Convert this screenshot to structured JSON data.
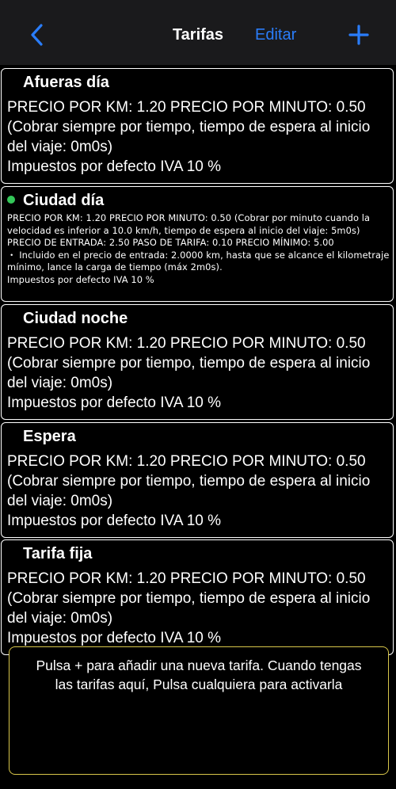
{
  "navbar": {
    "title": "Tarifas",
    "edit_label": "Editar",
    "back_icon": "chevron-left-icon",
    "add_icon": "plus-icon",
    "accent_color": "#2a7dfa"
  },
  "tariffs": [
    {
      "name": "Afueras día",
      "active": false,
      "lines": [
        "PRECIO POR KM: 1.20 PRECIO POR MINUTO: 0.50 (Cobrar siempre por tiempo, tiempo de espera al inicio del viaje: 0m0s)",
        "Impuestos por defecto IVA 10 %"
      ]
    },
    {
      "name": "Ciudad día",
      "active": true,
      "lines": [
        "PRECIO POR KM: 1.20 PRECIO POR MINUTO: 0.50 (Cobrar por minuto cuando la velocidad es inferior a 10.0 km/h, tiempo de espera al inicio del viaje: 5m0s) PRECIO DE ENTRADA: 2.50 PASO DE TARIFA: 0.10 PRECIO MÍNIMO: 5.00",
        "・ Incluido en el precio de entrada: 2.0000 km, hasta que se alcance el kilometraje mínimo, lance la carga de tiempo (máx 2m0s).",
        "Impuestos por defecto IVA 10 %"
      ]
    },
    {
      "name": "Ciudad noche",
      "active": false,
      "lines": [
        "PRECIO POR KM: 1.20 PRECIO POR MINUTO: 0.50 (Cobrar siempre por tiempo, tiempo de espera al inicio del viaje: 0m0s)",
        "Impuestos por defecto IVA 10 %"
      ]
    },
    {
      "name": "Espera",
      "active": false,
      "lines": [
        "PRECIO POR KM: 1.20 PRECIO POR MINUTO: 0.50 (Cobrar siempre por tiempo, tiempo de espera al inicio del viaje: 0m0s)",
        "Impuestos por defecto IVA 10 %"
      ]
    },
    {
      "name": "Tarifa fija",
      "active": false,
      "lines": [
        "PRECIO POR KM: 1.20 PRECIO POR MINUTO: 0.50 (Cobrar siempre por tiempo, tiempo de espera al inicio del viaje: 0m0s)",
        "Impuestos por defecto IVA 10 %"
      ]
    }
  ],
  "hint": {
    "text": "Pulsa + para añadir una nueva tarifa. Cuando tengas las tarifas aquí, Pulsa cualquiera para activarla",
    "border_color": "#d8c64a"
  },
  "active_indicator_color": "#34c759"
}
